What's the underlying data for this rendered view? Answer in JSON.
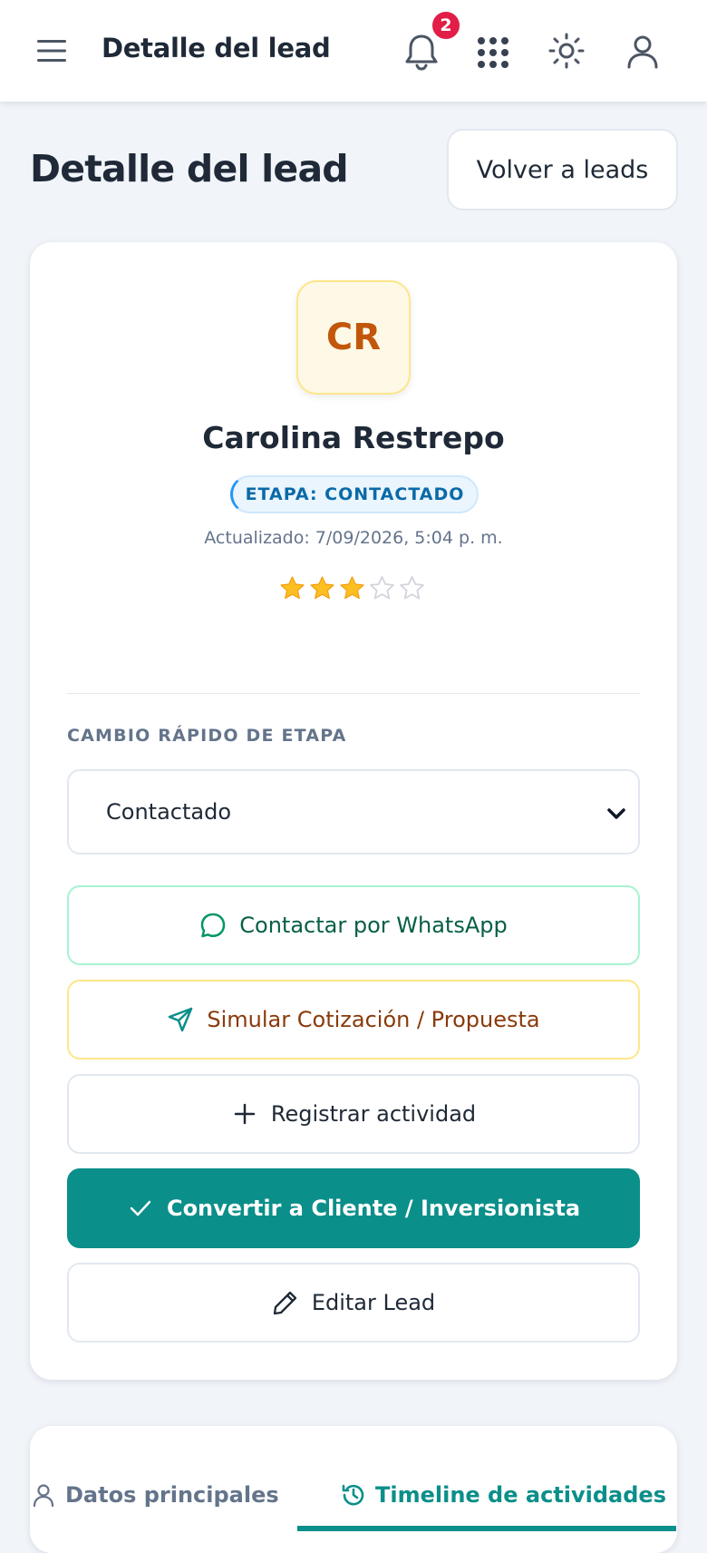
{
  "header": {
    "title": "Detalle del lead",
    "notification_count": "2"
  },
  "page": {
    "title": "Detalle del lead",
    "back_button": "Volver a leads"
  },
  "lead": {
    "initials": "CR",
    "name": "Carolina Restrepo",
    "stage_badge": "ETAPA: CONTACTADO",
    "updated": "Actualizado: 7/09/2026, 5:04 p. m.",
    "rating": 3,
    "rating_max": 5
  },
  "quick_stage": {
    "label": "CAMBIO RÁPIDO DE ETAPA",
    "selected": "Contactado"
  },
  "actions": {
    "whatsapp": "Contactar por WhatsApp",
    "simulate": "Simular Cotización / Propuesta",
    "register": "Registrar actividad",
    "convert": "Convertir a Cliente / Inversionista",
    "edit": "Editar Lead"
  },
  "tabs": {
    "main": "Datos principales",
    "timeline": "Timeline de actividades"
  },
  "colors": {
    "accent": "#0b8f8a",
    "star": "#fbbf24",
    "badge": "#e11d48"
  }
}
